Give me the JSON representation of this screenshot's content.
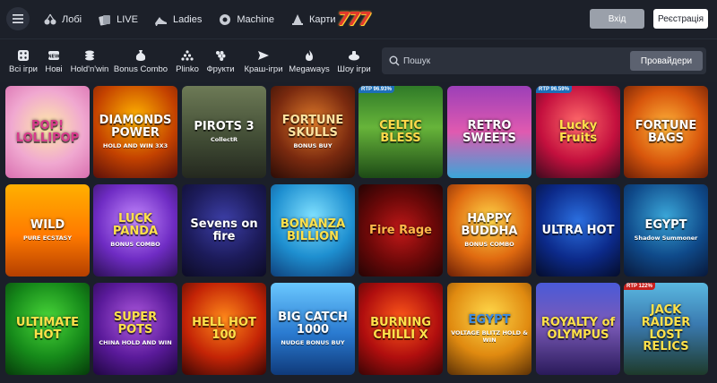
{
  "topnav": [
    {
      "label": "Лобі",
      "icon": "cherries-icon"
    },
    {
      "label": "LIVE",
      "icon": "cards-icon"
    },
    {
      "label": "Ladies",
      "icon": "heels-icon"
    },
    {
      "label": "Machine",
      "icon": "machine-icon"
    },
    {
      "label": "Карти",
      "icon": "wizard-hat-icon"
    }
  ],
  "logo": "777",
  "auth": {
    "login": "Вхід",
    "register": "Реєстрація"
  },
  "categories": [
    {
      "label": "Всі ігри",
      "icon": "dice-icon"
    },
    {
      "label": "Нові",
      "icon": "new-icon"
    },
    {
      "label": "Hold'n'win",
      "icon": "coins-icon"
    },
    {
      "label": "Bonus Combo",
      "icon": "money-bag-icon"
    },
    {
      "label": "Plinko",
      "icon": "plinko-icon"
    },
    {
      "label": "Фрукти",
      "icon": "grapes-icon"
    },
    {
      "label": "Краш-ігри",
      "icon": "plane-icon"
    },
    {
      "label": "Megaways",
      "icon": "flame-icon"
    },
    {
      "label": "Шоу ігри",
      "icon": "show-icon"
    }
  ],
  "search": {
    "placeholder": "Пошук",
    "providers_label": "Провайдери"
  },
  "colors": {
    "bg": "#1b1f29",
    "bar": "#1c2029",
    "search_bg": "#2c313c",
    "rtp_blue": "#1d6fb8",
    "rtp_red": "#c9201d"
  },
  "games": [
    {
      "title": "POP! LOLLIPOP",
      "sub": "",
      "rtp": "",
      "bg": "radial-gradient(circle at 50% 45%,#ffe9a8,#f0a8d0 55%,#d96fb0)",
      "color": "#d83a8c"
    },
    {
      "title": "DIAMONDS POWER",
      "sub": "HOLD AND WIN 3X3",
      "rtp": "",
      "bg": "radial-gradient(circle at 50% 35%,#ffb400,#c44200 55%,#5a0f0a)",
      "color": "#ffffff"
    },
    {
      "title": "PIROTS 3",
      "sub": "CollectR",
      "rtp": "",
      "bg": "linear-gradient(180deg,#6d7a56,#3f4a33 60%,#24281f)",
      "color": "#ffffff"
    },
    {
      "title": "FORTUNE SKULLS",
      "sub": "BONUS BUY",
      "rtp": "",
      "bg": "radial-gradient(circle at 50% 40%,#e07b2a,#7a2a0f 55%,#2a0c06)",
      "color": "#ffe3a0"
    },
    {
      "title": "CELTIC BLESS",
      "sub": "",
      "rtp": "RTP 96.93%",
      "rtp_color": "blue",
      "bg": "linear-gradient(180deg,#2f7a28,#67b43a 45%,#1d4a16)",
      "color": "#ffd84a"
    },
    {
      "title": "RETRO SWEETS",
      "sub": "",
      "rtp": "",
      "bg": "linear-gradient(180deg,#9c3fb8,#e05ab0 50%,#3aa6d8)",
      "color": "#ffffff"
    },
    {
      "title": "Lucky Fruits",
      "sub": "",
      "rtp": "RTP 96.59%",
      "rtp_color": "blue",
      "bg": "radial-gradient(circle at 50% 40%,#ff6a6a,#c4103e 55%,#3e0a1e)",
      "color": "#ffe14a"
    },
    {
      "title": "FORTUNE BAGS",
      "sub": "",
      "rtp": "",
      "bg": "radial-gradient(circle at 50% 45%,#ffb43a,#d8560c 55%,#6a1e06)",
      "color": "#ffffff"
    },
    {
      "title": "WILD",
      "sub": "PURE ECSTASY",
      "rtp": "",
      "bg": "linear-gradient(180deg,#ffb000,#ff7a00 55%,#b43f00)",
      "color": "#ffffff"
    },
    {
      "title": "LUCK PANDA",
      "sub": "BONUS COMBO",
      "rtp": "",
      "bg": "radial-gradient(circle at 50% 40%,#c58aff,#6f2cc4 55%,#2a0f52)",
      "color": "#ffe14a"
    },
    {
      "title": "Sevens on fire",
      "sub": "",
      "rtp": "",
      "bg": "radial-gradient(circle at 50% 40%,#3d3fa8,#1c1b5a 55%,#0c0b24)",
      "color": "#ffffff"
    },
    {
      "title": "BONANZA BILLION",
      "sub": "",
      "rtp": "",
      "bg": "radial-gradient(circle at 50% 35%,#7fe0ff,#1e8fd0 55%,#0f3f7a)",
      "color": "#ffe14a"
    },
    {
      "title": "Fire Rage",
      "sub": "",
      "rtp": "",
      "bg": "radial-gradient(circle at 50% 50%,#c01818,#6a0808 55%,#240404)",
      "color": "#ffb84a"
    },
    {
      "title": "HAPPY BUDDHA",
      "sub": "BONUS COMBO",
      "rtp": "",
      "bg": "radial-gradient(circle at 50% 40%,#ffd84a,#e06a10 55%,#6a1e06)",
      "color": "#ffffff"
    },
    {
      "title": "ULTRA HOT",
      "sub": "",
      "rtp": "",
      "bg": "radial-gradient(circle at 50% 40%,#2b6fe0,#0c2a8a 55%,#040c2a)",
      "color": "#ffffff"
    },
    {
      "title": "EGYPT",
      "sub": "Shadow Summoner",
      "rtp": "",
      "bg": "radial-gradient(circle at 50% 35%,#3aa6d8,#0f4a8a 55%,#08183a)",
      "color": "#ffffff"
    },
    {
      "title": "ULTIMATE HOT",
      "sub": "",
      "rtp": "",
      "bg": "radial-gradient(circle at 50% 40%,#4ad83a,#168a1a 55%,#063a0a)",
      "color": "#ffe14a"
    },
    {
      "title": "SUPER POTS",
      "sub": "CHINA HOLD AND WIN",
      "rtp": "",
      "bg": "radial-gradient(circle at 50% 40%,#b05ae0,#5a1a9a 55%,#1e0640)",
      "color": "#ffe14a"
    },
    {
      "title": "HELL HOT 100",
      "sub": "",
      "rtp": "",
      "bg": "radial-gradient(circle at 50% 40%,#ff8a1a,#c42406 55%,#3a0604)",
      "color": "#ffe14a"
    },
    {
      "title": "BIG CATCH 1000",
      "sub": "NUDGE BONUS BUY",
      "rtp": "",
      "bg": "linear-gradient(180deg,#6ac8ff,#2a7ad0 55%,#0f3a7a)",
      "color": "#ffffff"
    },
    {
      "title": "BURNING CHILLI X",
      "sub": "",
      "rtp": "",
      "bg": "radial-gradient(circle at 50% 40%,#ff5a1a,#b00e0e 55%,#3a0404)",
      "color": "#ffe14a"
    },
    {
      "title": "EGYPT",
      "sub": "VOLTAGE BLITZ HOLD & WIN",
      "rtp": "",
      "bg": "radial-gradient(circle at 50% 35%,#ffd84a,#e08a10 55%,#5a3006)",
      "color": "#3a8ae0"
    },
    {
      "title": "ROYALTY of OLYMPUS",
      "sub": "",
      "rtp": "",
      "bg": "linear-gradient(180deg,#4a5ad8,#7a5ab8 45%,#2a1a5a)",
      "color": "#ffe14a"
    },
    {
      "title": "JACK RAIDER LOST RELICS",
      "sub": "",
      "rtp": "RTP 122%",
      "rtp_color": "red",
      "bg": "linear-gradient(180deg,#5ab8e0,#3a7ab0 45%,#1e3a2a)",
      "color": "#ffe14a"
    }
  ]
}
